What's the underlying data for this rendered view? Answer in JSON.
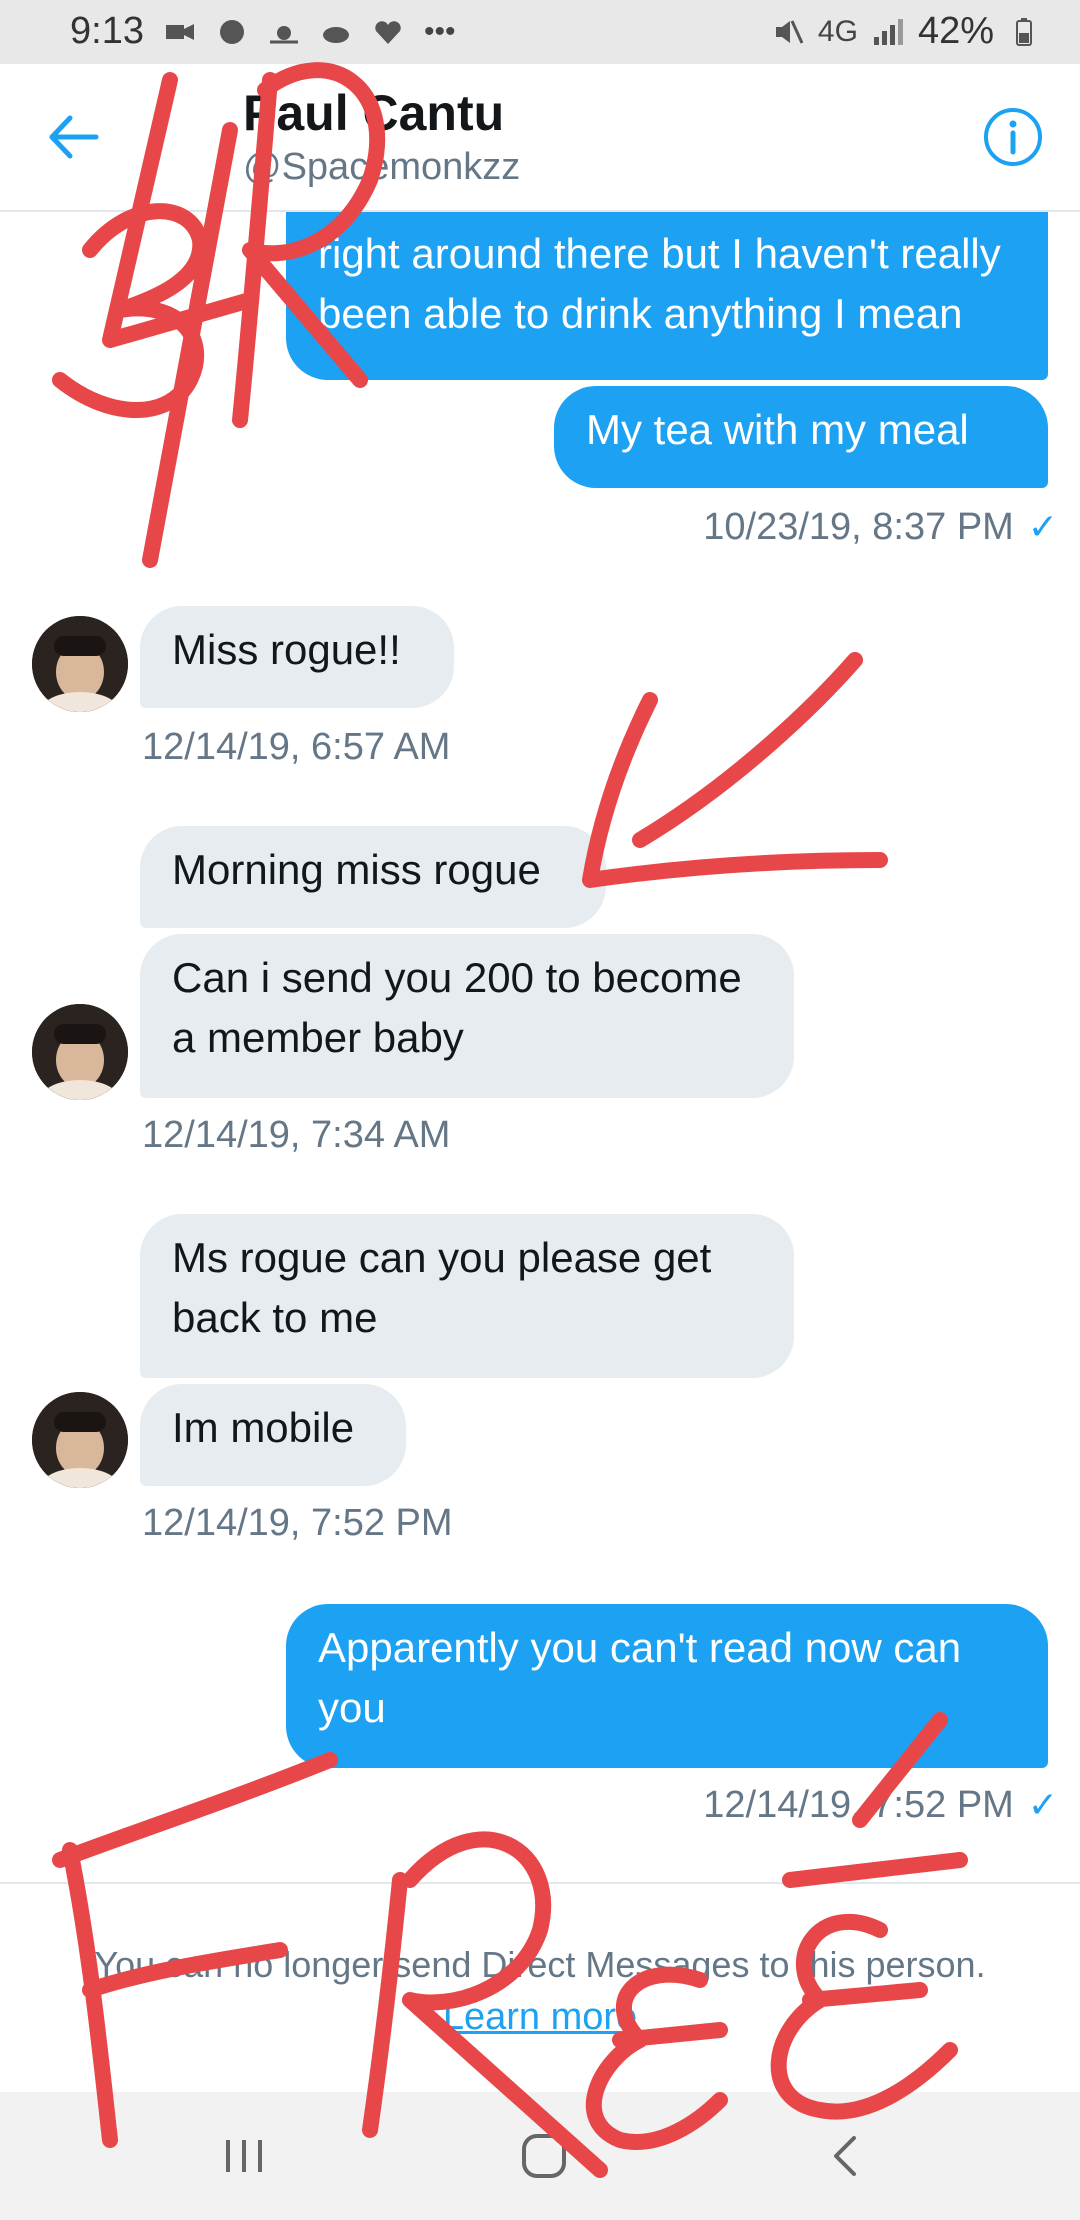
{
  "status_bar": {
    "time": "9:13",
    "network": "4G",
    "battery": "42%"
  },
  "header": {
    "name": "Paul Cantu",
    "handle": "@Spacemonkzz"
  },
  "messages": {
    "m1": "right around there but I haven't really been able to drink anything I mean",
    "m2": "My tea with  my meal",
    "ts1": "10/23/19, 8:37 PM",
    "m3": "Miss rogue!!",
    "ts2": "12/14/19, 6:57 AM",
    "m4": "Morning miss rogue",
    "m5": "Can i send you 200 to become a member baby",
    "ts3": "12/14/19, 7:34 AM",
    "m6": "Ms rogue can you please get back to me",
    "m7": "Im mobile",
    "ts4": "12/14/19, 7:52 PM",
    "m8": "Apparently you can't read now can you",
    "ts5": "12/14/19, 7:52 PM",
    "check": "✓"
  },
  "footer": {
    "notice": "You can no longer send Direct Messages to this person.",
    "link": "Learn more"
  },
  "colors": {
    "accent": "#1da1f2",
    "received_bubble": "#e6ecf0",
    "scribble": "#e8474a"
  },
  "icons": [
    "back-arrow-icon",
    "info-icon",
    "recents-icon",
    "home-icon",
    "back-icon"
  ]
}
